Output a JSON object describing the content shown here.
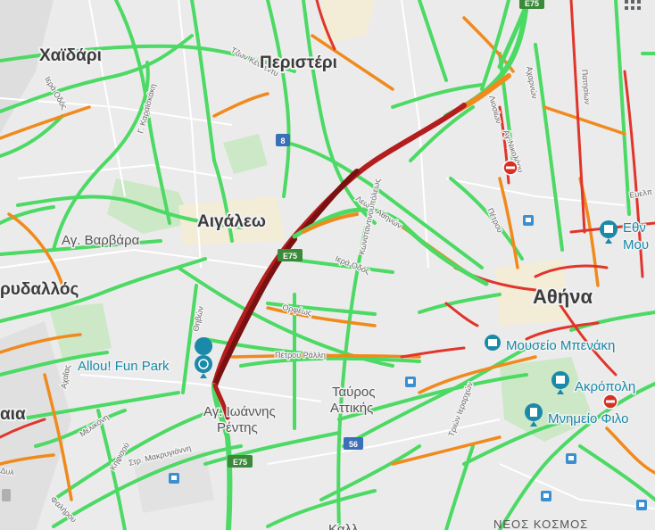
{
  "map": {
    "places": {
      "chaidari": "Χαϊδάρι",
      "peristeri": "Περιστέρι",
      "aigaleo": "Αιγάλεω",
      "ag_varvara": "Αγ. Βαρβάρα",
      "korydallos": "ρυδαλλός",
      "nikaia": "αια",
      "athina": "Αθήνα",
      "tavros_1": "Ταύρος",
      "tavros_2": "Αττικής",
      "ag_ioannis_1": "Αγ. Ιωάννης",
      "ag_ioannis_2": "Ρέντης",
      "neos_kosmos": "ΝΕΟΣ ΚΟΣΜΟΣ",
      "kall": "Καλλ"
    },
    "pois": {
      "allou": "Allou! Fun Park",
      "benaki": "Μουσείο Μπενάκη",
      "akropoli": "Ακρόπολη",
      "filopappou": "Μνημείο Φιλο",
      "ethniko_1": "Εθν",
      "ethniko_2": "Μου"
    },
    "streets": {
      "leof_athinon": "Λεωφ. Αθηνών",
      "iera_odos": "Ιερά Οδός",
      "petrou_ralli": "Πέτρου Ράλλη",
      "orfeos": "Ορφέως",
      "thivon": "Θηβών",
      "konstantinoupoleos": "Κωνσταντινουπόλεως",
      "makrygianni": "Στρ. Μακρυγιάννη",
      "tzon_kennenty": "Τζων Κέννεντυ",
      "karaiskaki": "Γ. Καραϊσκάκη",
      "iera_odos_left": "Ιερά Οδός",
      "liosion": "Λιοσίων",
      "acharnon": "Αχαρνών",
      "patision": "Πατησίων",
      "petrou": "Πέτρου",
      "triton_ierarchon": "Τριών Ιεραρχών",
      "evelp": "Ευελπ",
      "ag_nikolaou": "Αγ.Νικολάου",
      "melikoni": "Μελικόνη",
      "kifisou": "Κηφισού",
      "falirou": "Φαλήρου",
      "achaias": "Αχαΐας",
      "thivon2": "Θηβών",
      "dyl": "Δυλ",
      "kifisias": "Κηφισίας",
      "metaxa": "Μ"
    },
    "shields": {
      "e75_top": "E75",
      "e75_mid": "E75",
      "e75_bot": "E75",
      "route_8": "8",
      "route_56": "56"
    },
    "colors": {
      "fast": "#4cd964",
      "medium": "#f08a1c",
      "slow": "#e0352b",
      "stopped": "#7a1111",
      "background": "#ebebeb",
      "park": "#cde8c7",
      "poi": "#1a8aa8",
      "closure": "#d93025"
    }
  }
}
